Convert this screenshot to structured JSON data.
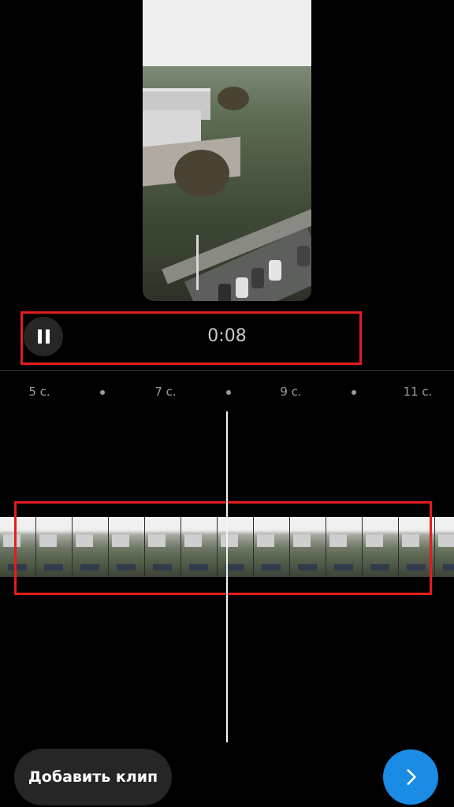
{
  "player": {
    "current_time": "0:08",
    "state": "playing",
    "pause_icon": "pause-icon"
  },
  "ruler": {
    "ticks": [
      "5 с.",
      "7 с.",
      "9 с.",
      "11 с."
    ]
  },
  "bottom": {
    "add_clip_label": "Добавить клип",
    "next_icon": "chevron-right-icon"
  },
  "colors": {
    "accent": "#1a8ce6",
    "highlight": "#e11d1d",
    "background": "#000000"
  }
}
